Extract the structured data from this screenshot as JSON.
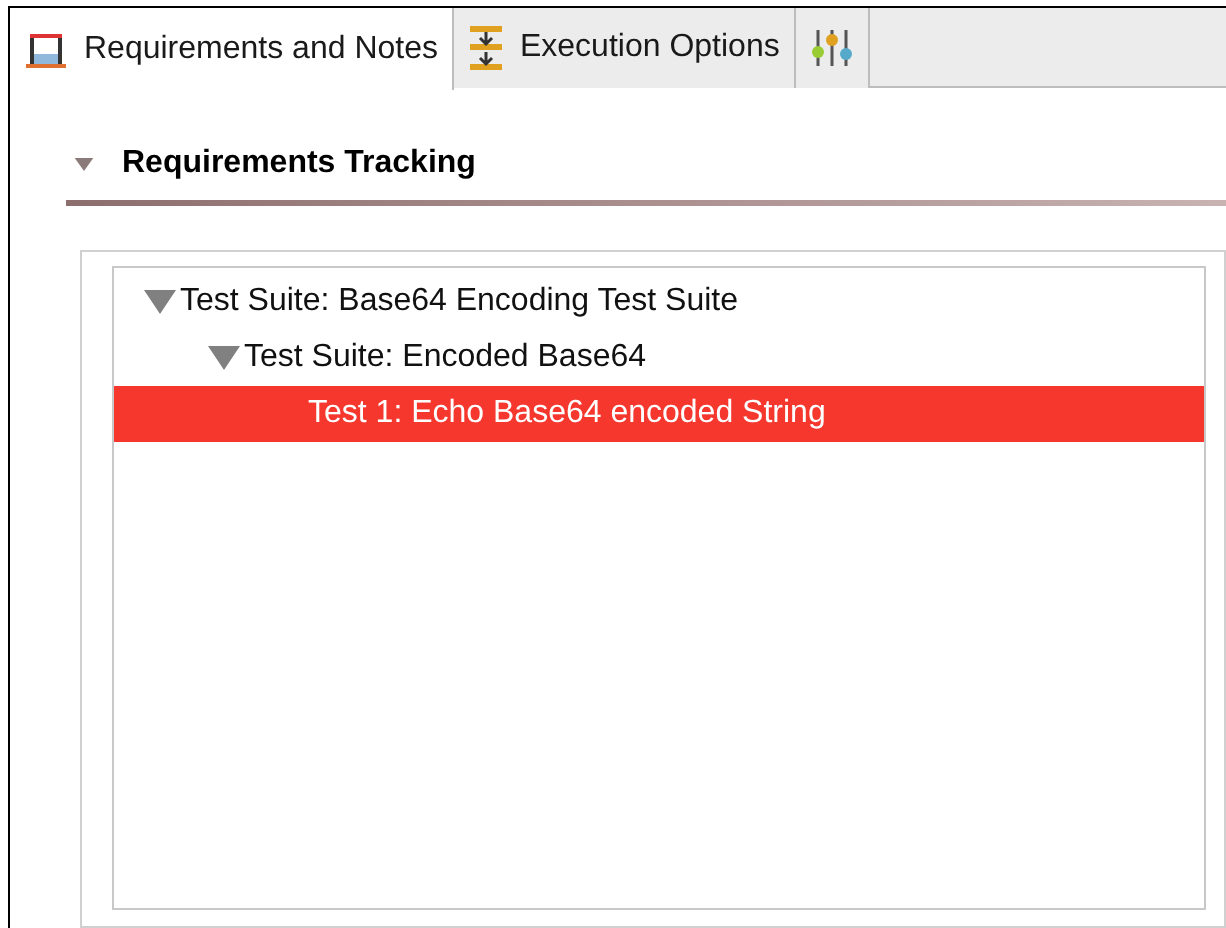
{
  "tabs": [
    {
      "label": "Requirements and Notes",
      "selected": true
    },
    {
      "label": "Execution Options",
      "selected": false
    },
    {
      "selected": false
    }
  ],
  "section": {
    "title": "Requirements Tracking",
    "expanded": true
  },
  "tree": [
    {
      "label": "Test Suite: Base64 Encoding Test Suite",
      "expanded": true,
      "selected": false,
      "children": [
        {
          "label": "Test Suite: Encoded Base64",
          "expanded": true,
          "selected": false,
          "children": [
            {
              "label": "Test 1: Echo Base64 encoded String",
              "selected": true
            }
          ]
        }
      ]
    }
  ]
}
